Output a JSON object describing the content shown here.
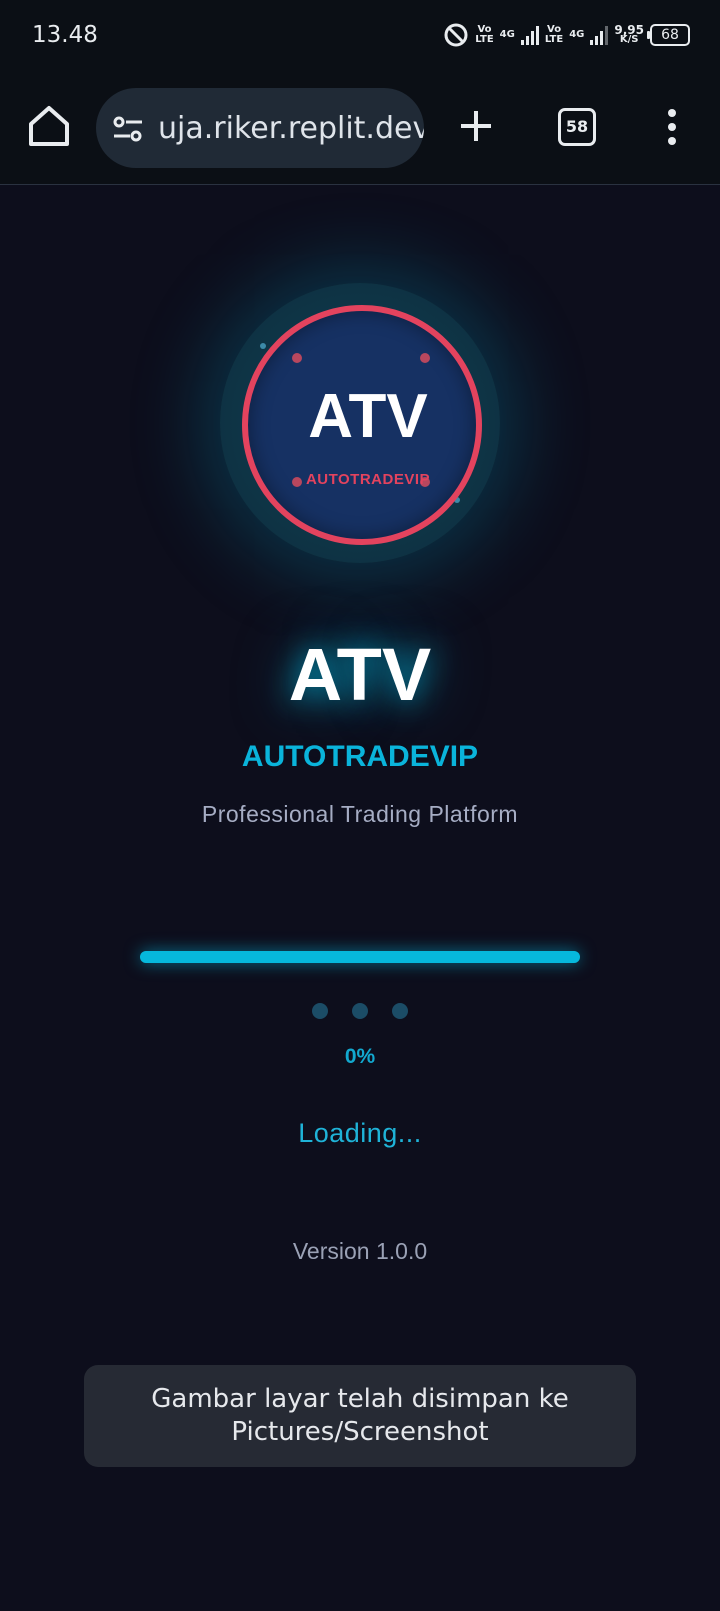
{
  "status_bar": {
    "time": "13.48",
    "net_speed": "9,95",
    "net_speed_unit": "K/S",
    "battery": "68",
    "sim1_label_top": "Vo",
    "sim1_label_bottom": "LTE",
    "sim2_label_top": "Vo",
    "sim2_label_bottom": "LTE",
    "net1": "4G",
    "net2": "4G",
    "icons": [
      "do-not-disturb-icon",
      "signal-icon",
      "battery-icon"
    ]
  },
  "browser": {
    "url": "uja.riker.replit.dev",
    "tab_count": "58",
    "icons": [
      "home-icon",
      "site-settings-icon",
      "new-tab-icon",
      "tabs-icon",
      "more-menu-icon"
    ]
  },
  "logo": {
    "big_text": "ATV",
    "small_text": "AUTOTRADEVIP",
    "ring_color": "#e3435e",
    "fill_color": "#163163"
  },
  "hero": {
    "title": "ATV",
    "subtitle": "AUTOTRADEVIP",
    "tagline": "Professional Trading Platform"
  },
  "loader": {
    "progress_fraction": 1.0,
    "percent_text": "0%",
    "status_text": "Loading...",
    "accent_color": "#06b8dc"
  },
  "footer": {
    "version": "Version 1.0.0"
  },
  "toast": {
    "message": "Gambar layar telah disimpan ke Pictures/Screenshot"
  }
}
